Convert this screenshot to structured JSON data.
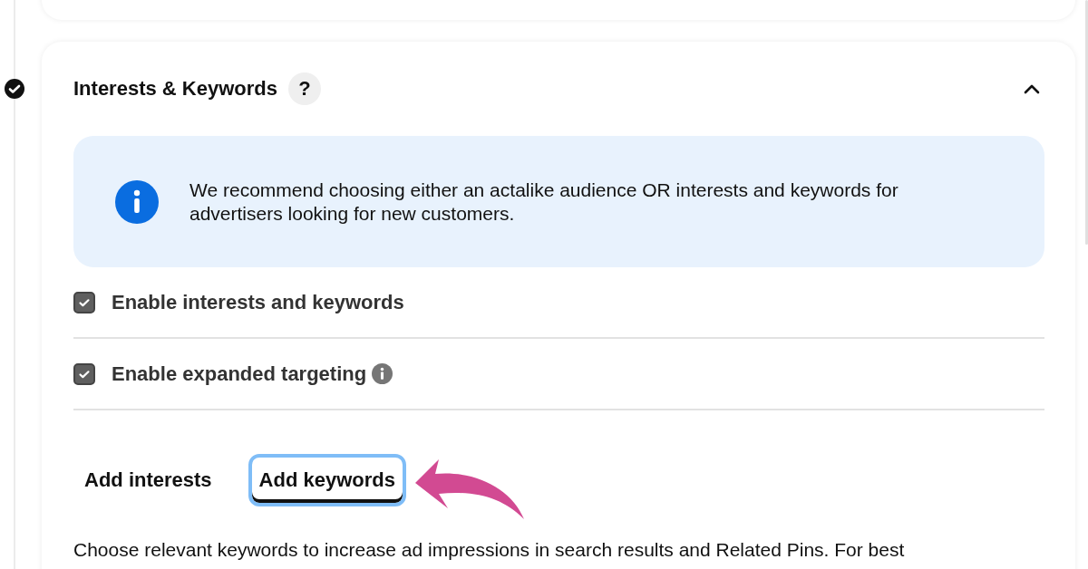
{
  "section": {
    "title": "Interests & Keywords",
    "help": "?",
    "completed": true,
    "expanded": true
  },
  "notice": {
    "text": "We recommend choosing either an actalike audience OR interests and keywords for advertisers looking for new customers."
  },
  "options": [
    {
      "label": "Enable interests and keywords",
      "checked": true,
      "info": false
    },
    {
      "label": "Enable expanded targeting",
      "checked": true,
      "info": true
    }
  ],
  "tabs": [
    {
      "label": "Add interests",
      "selected": false
    },
    {
      "label": "Add keywords",
      "selected": true
    }
  ],
  "description": "Choose relevant keywords to increase ad impressions in search results and Related Pins. For best"
}
